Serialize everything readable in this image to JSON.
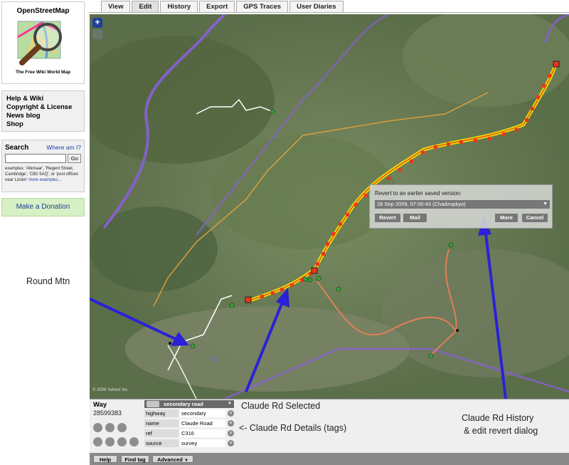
{
  "app": {
    "logo_title": "OpenStreetMap",
    "logo_tagline": "The Free Wiki World Map"
  },
  "sidebar": {
    "links": [
      "Help & Wiki",
      "Copyright & License",
      "News blog",
      "Shop"
    ],
    "search": {
      "title": "Search",
      "where_link": "Where am I?",
      "input_value": "",
      "go_label": "Go",
      "examples_text": "examples: 'Alkmaar', 'Regent Street, Cambridge', 'CB2 5AQ', or 'post offices near Lünen'",
      "more_link": "more examples..."
    },
    "donate_label": "Make a Donation"
  },
  "tabs": [
    {
      "label": "View",
      "active": false
    },
    {
      "label": "Edit",
      "active": true
    },
    {
      "label": "History",
      "active": false
    },
    {
      "label": "Export",
      "active": false
    },
    {
      "label": "GPS Traces",
      "active": false
    },
    {
      "label": "User Diaries",
      "active": false
    }
  ],
  "map": {
    "zoom_in_label": "+",
    "copyright": "© 2006 Yahoo! Inc.",
    "revert_dialog": {
      "label": "Revert to an earlier saved version:",
      "selected_version": "28 Sep 2009, 07:00:43 (Chadzopkyo)",
      "buttons": {
        "revert": "Revert",
        "mail": "Mail",
        "more": "More",
        "cancel": "Cancel"
      }
    }
  },
  "panel": {
    "title": "Way",
    "way_id": "28599383",
    "preset": "secondary road",
    "tags": [
      {
        "key": "highway",
        "value": "secondary"
      },
      {
        "key": "name",
        "value": "Claude Road"
      },
      {
        "key": "ref",
        "value": "C316"
      },
      {
        "key": "source",
        "value": "survey"
      }
    ],
    "bottom_buttons": {
      "help": "Help",
      "find_tag": "Find tag",
      "advanced": "Advanced"
    }
  },
  "annotations": {
    "round_mtn": "Round Mtn",
    "selected": "Claude Rd Selected",
    "details": "<- Claude Rd Details (tags)",
    "history_line1": "Claude Rd History",
    "history_line2": "& edit revert dialog"
  },
  "colors": {
    "selected_way": "#f0e000",
    "node_marker": "#e83818",
    "river_track": "#ee7f55",
    "boundary": "#8a5fd8",
    "arrow": "#2b21d8"
  }
}
